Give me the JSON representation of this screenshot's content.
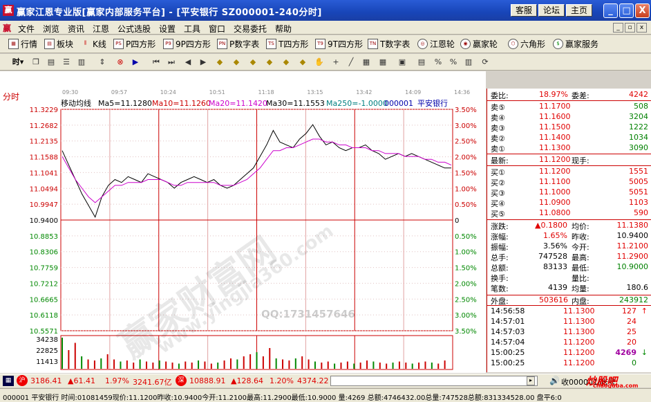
{
  "titlebar": {
    "title": "赢家江恩专业版[赢家内部服务平台] - [平安银行   SZ000001-240分时]",
    "buttons": [
      "客服",
      "论坛",
      "主页"
    ],
    "minimize": "_",
    "maximize": "□",
    "close": "X"
  },
  "menubar": {
    "items": [
      "文件",
      "浏览",
      "资讯",
      "江恩",
      "公式选股",
      "设置",
      "工具",
      "窗口",
      "交易委托",
      "帮助"
    ],
    "mdi": [
      "_",
      "▫",
      "x"
    ]
  },
  "toolbar1": {
    "items": [
      {
        "icon": "grid-icon",
        "label": "行情"
      },
      {
        "icon": "blocks-icon",
        "label": "板块"
      },
      {
        "icon": "kline-icon",
        "label": "K线"
      },
      {
        "icon": "PS",
        "label": "P四方形"
      },
      {
        "icon": "P9",
        "label": "9P四方形"
      },
      {
        "icon": "PN",
        "label": "P数字表"
      },
      {
        "icon": "TS",
        "label": "T四方形"
      },
      {
        "icon": "T9",
        "label": "9T四方形"
      },
      {
        "icon": "TN",
        "label": "T数字表"
      },
      {
        "icon": "wheel-icon",
        "label": "江恩轮"
      },
      {
        "icon": "wheel2-icon",
        "label": "赢家轮"
      },
      {
        "icon": "hexagon-icon",
        "label": "六角形"
      },
      {
        "icon": "dollar-icon",
        "label": "赢家服务"
      }
    ]
  },
  "toolbar2": {
    "period_label": "时"
  },
  "chart": {
    "tab_label": "分时",
    "indicator_label": "移动均线",
    "ma_labels": [
      "Ma5=11.1280",
      "Ma10=11.1260",
      "Ma20=11.1420",
      "Ma30=11.1553",
      "Ma250=-1.0000"
    ],
    "stock_code": "000001",
    "stock_name": "平安银行",
    "time_ticks": [
      "09:30",
      "09:57",
      "10:24",
      "10:51",
      "11:18",
      "13:15",
      "13:42",
      "14:09",
      "14:36"
    ],
    "watermark_qq": "QQ:1731457646",
    "watermark_url": "www.yingjia360.com",
    "watermark_text": "赢家财富网"
  },
  "chart_data": {
    "type": "line",
    "x_range": [
      "09:30",
      "15:00"
    ],
    "price_ticks": [
      "11.3229",
      "11.2682",
      "11.2135",
      "11.1588",
      "11.1041",
      "11.0494",
      "10.9947",
      "10.9400",
      "10.8853",
      "10.8306",
      "10.7759",
      "10.7212",
      "10.6665",
      "10.6118",
      "10.5571"
    ],
    "pct_ticks": [
      "3.50%",
      "3.00%",
      "2.50%",
      "2.00%",
      "1.50%",
      "1.00%",
      "0.50%",
      "0",
      "0.50%",
      "1.00%",
      "1.50%",
      "2.00%",
      "2.50%",
      "3.00%",
      "3.50%"
    ],
    "ylim": [
      10.5571,
      11.3229
    ],
    "volume_ticks": [
      "34238",
      "22825",
      "11413"
    ],
    "series": [
      {
        "values": [
          11.18,
          11.13,
          11.08,
          11.03,
          10.99,
          10.95,
          11.02,
          11.06,
          11.08,
          11.07,
          11.09,
          11.08,
          11.07,
          11.1,
          11.09,
          11.08,
          11.07,
          11.05,
          11.07,
          11.08,
          11.09,
          11.08,
          11.07,
          11.08,
          11.06,
          11.05,
          11.06,
          11.08,
          11.1,
          11.12,
          11.16,
          11.2,
          11.25,
          11.21,
          11.2,
          11.19,
          11.22,
          11.24,
          11.27,
          11.23,
          11.2,
          11.21,
          11.19,
          11.18,
          11.19,
          11.19,
          11.2,
          11.18,
          11.17,
          11.15,
          11.16,
          11.17,
          11.16,
          11.17,
          11.16,
          11.15,
          11.14,
          11.13,
          11.12,
          11.12
        ]
      },
      {
        "values": [
          11.16,
          11.12,
          11.08,
          11.05,
          11.02,
          11.0,
          11.02,
          11.04,
          11.06,
          11.06,
          11.07,
          11.07,
          11.07,
          11.08,
          11.08,
          11.08,
          11.07,
          11.06,
          11.06,
          11.07,
          11.07,
          11.07,
          11.07,
          11.07,
          11.06,
          11.06,
          11.06,
          11.07,
          11.08,
          11.1,
          11.12,
          11.15,
          11.18,
          11.18,
          11.19,
          11.19,
          11.2,
          11.21,
          11.22,
          11.22,
          11.21,
          11.21,
          11.2,
          11.2,
          11.19,
          11.19,
          11.19,
          11.18,
          11.18,
          11.17,
          11.17,
          11.17,
          11.16,
          11.16,
          11.16,
          11.15,
          11.15,
          11.14,
          11.14,
          11.13
        ]
      }
    ],
    "volume": [
      30,
      18,
      25,
      12,
      9,
      8,
      10,
      14,
      9,
      7,
      8,
      6,
      9,
      7,
      6,
      8,
      7,
      6,
      5,
      7,
      6,
      8,
      7,
      5,
      6,
      8,
      10,
      9,
      12,
      14,
      16,
      12,
      20,
      10,
      9,
      8,
      10,
      12,
      9,
      7,
      6,
      7,
      5,
      6,
      7,
      5,
      6,
      8,
      7,
      6,
      5,
      6,
      7,
      6,
      5,
      6,
      7,
      6,
      5,
      8
    ]
  },
  "rpanel": {
    "weibi_label": "委比:",
    "weibi": "18.97%",
    "weicha_label": "委差:",
    "weicha": "4242",
    "sells": [
      {
        "label": "卖⑤",
        "price": "11.1700",
        "vol": "508"
      },
      {
        "label": "卖④",
        "price": "11.1600",
        "vol": "3204"
      },
      {
        "label": "卖③",
        "price": "11.1500",
        "vol": "1222"
      },
      {
        "label": "卖②",
        "price": "11.1400",
        "vol": "1034"
      },
      {
        "label": "卖①",
        "price": "11.1300",
        "vol": "3090"
      }
    ],
    "latest_label": "最新:",
    "latest": "11.1200",
    "xianshou_label": "现手:",
    "buys": [
      {
        "label": "买①",
        "price": "11.1200",
        "vol": "1551"
      },
      {
        "label": "买②",
        "price": "11.1100",
        "vol": "5005"
      },
      {
        "label": "买③",
        "price": "11.1000",
        "vol": "5051"
      },
      {
        "label": "买④",
        "price": "11.0900",
        "vol": "1103"
      },
      {
        "label": "买⑤",
        "price": "11.0800",
        "vol": "590"
      }
    ],
    "stats": [
      {
        "l1": "涨跌:",
        "v1": "▲0.1800",
        "c1": "red",
        "l2": "均价:",
        "v2": "11.1380",
        "c2": "red"
      },
      {
        "l1": "涨幅:",
        "v1": "1.65%",
        "c1": "red",
        "l2": "昨收:",
        "v2": "10.9400",
        "c2": "black"
      },
      {
        "l1": "振幅:",
        "v1": "3.56%",
        "c1": "black",
        "l2": "今开:",
        "v2": "11.2100",
        "c2": "red"
      },
      {
        "l1": "总手:",
        "v1": "747528",
        "c1": "black",
        "l2": "最高:",
        "v2": "11.2900",
        "c2": "red"
      },
      {
        "l1": "总额:",
        "v1": "83133",
        "c1": "black",
        "l2": "最低:",
        "v2": "10.9000",
        "c2": "green"
      },
      {
        "l1": "换手:",
        "v1": "",
        "c1": "black",
        "l2": "量比:",
        "v2": "",
        "c2": "black"
      },
      {
        "l1": "笔数:",
        "v1": "4139",
        "c1": "black",
        "l2": "均量:",
        "v2": "180.6",
        "c2": "black"
      }
    ],
    "waipan_label": "外盘:",
    "waipan": "503616",
    "neipan_label": "内盘:",
    "neipan": "243912",
    "ticks": [
      {
        "time": "14:56:58",
        "price": "11.1300",
        "vol": "127",
        "arrow": "↑",
        "color": "red"
      },
      {
        "time": "14:57:01",
        "price": "11.1300",
        "vol": "24",
        "arrow": "",
        "color": "red"
      },
      {
        "time": "14:57:03",
        "price": "11.1300",
        "vol": "25",
        "arrow": "",
        "color": "red"
      },
      {
        "time": "14:57:04",
        "price": "11.1200",
        "vol": "20",
        "arrow": "",
        "color": "red"
      },
      {
        "time": "15:00:25",
        "price": "11.1200",
        "vol": "4269",
        "arrow": "↓",
        "color": "purple"
      },
      {
        "time": "15:00:25",
        "price": "11.1200",
        "vol": "0",
        "arrow": "",
        "color": "green"
      }
    ]
  },
  "status1": {
    "sh_index": "3186.41",
    "sh_change": "▲61.41",
    "sh_pct": "1.97%",
    "sh_amount": "3241.67亿",
    "sz_index": "10888.91",
    "sz_change": "▲128.64",
    "sz_pct": "1.20%",
    "sz_amount": "4374.22",
    "right_text": "收000001/帐号",
    "logo_text": "炒股吧",
    "logo_url": "chaoguba.com"
  },
  "status2": {
    "text": "000001 平安银行 时间:01081459现价:11.1200昨收:10.9400今开:11.2100最高:11.2900最低:10.9000 量:4269 总额:4746432.00总量:747528总额:831334528.00 盘平6:0"
  }
}
